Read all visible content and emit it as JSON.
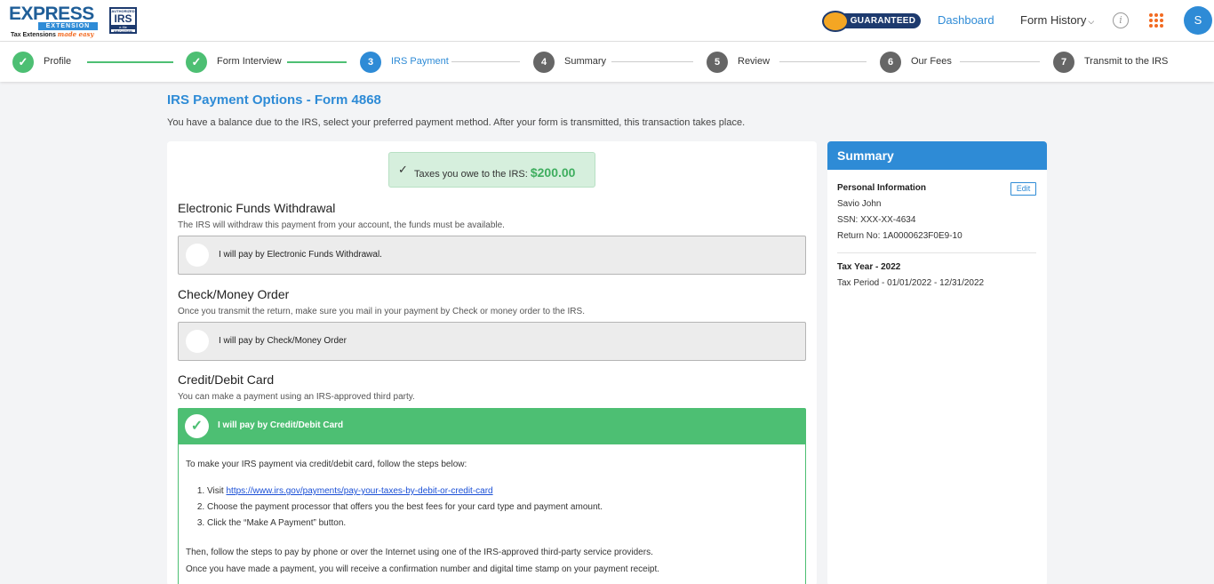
{
  "header": {
    "logo": {
      "top": "EXPRESS",
      "ext": "EXTENSION",
      "tag": "Tax Extensions",
      "tag_italic": "made easy"
    },
    "irs_badge": {
      "top": "AUTHORIZED",
      "big": "IRS",
      "bar": "e-file",
      "bottom": "PROVIDER"
    },
    "guarantee_label": "GUARANTEED",
    "nav": {
      "dashboard": "Dashboard",
      "form_history": "Form History"
    },
    "avatar_initial": "S"
  },
  "stepper": {
    "steps": [
      {
        "number": "✓",
        "label": "Profile",
        "state": "done"
      },
      {
        "number": "✓",
        "label": "Form Interview",
        "state": "done"
      },
      {
        "number": "3",
        "label": "IRS Payment",
        "state": "active"
      },
      {
        "number": "4",
        "label": "Summary",
        "state": "todo"
      },
      {
        "number": "5",
        "label": "Review",
        "state": "todo"
      },
      {
        "number": "6",
        "label": "Our Fees",
        "state": "todo"
      },
      {
        "number": "7",
        "label": "Transmit to the IRS",
        "state": "todo"
      }
    ]
  },
  "main": {
    "title": "IRS Payment Options - Form 4868",
    "subtitle": "You have a balance due to the IRS, select your preferred payment method. After your form is transmitted, this transaction takes place.",
    "owe": {
      "label": "Taxes you owe to the IRS:",
      "amount": "$200.00"
    },
    "efw": {
      "title": "Electronic Funds Withdrawal",
      "desc": "The IRS will withdraw this payment from your account, the funds must be available.",
      "option": "I will pay by Electronic Funds Withdrawal."
    },
    "check": {
      "title": "Check/Money Order",
      "desc": "Once you transmit the return, make sure you mail in your payment by Check or money order to the IRS.",
      "option": "I will pay by Check/Money Order"
    },
    "card": {
      "title": "Credit/Debit Card",
      "desc": "You can make a payment using an IRS-approved third party.",
      "option": "I will pay by Credit/Debit Card",
      "intro": "To make your IRS payment via credit/debit card, follow the steps below:",
      "step1_prefix": "Visit",
      "step1_link": "https://www.irs.gov/payments/pay-your-taxes-by-debit-or-credit-card",
      "step2": "Choose the payment processor that offers you the best fees for your card type and payment amount.",
      "step3": "Click the “Make A Payment” button.",
      "outro1": "Then, follow the steps to pay by phone or over the Internet using one of the IRS-approved third-party service providers.",
      "outro2": "Once you have made a payment, you will receive a confirmation number and digital time stamp on your payment receipt."
    }
  },
  "summary": {
    "title": "Summary",
    "personal_label": "Personal Information",
    "edit_label": "Edit",
    "name": "Savio John",
    "ssn": "SSN: XXX-XX-4634",
    "return_no": "Return No: 1A0000623F0E9-10",
    "tax_year": "Tax Year - 2022",
    "tax_period": "Tax Period - 01/01/2022 - 12/31/2022"
  },
  "colors": {
    "primary": "#2e8bd6",
    "success": "#4dbf73",
    "accent": "#f26a21"
  }
}
